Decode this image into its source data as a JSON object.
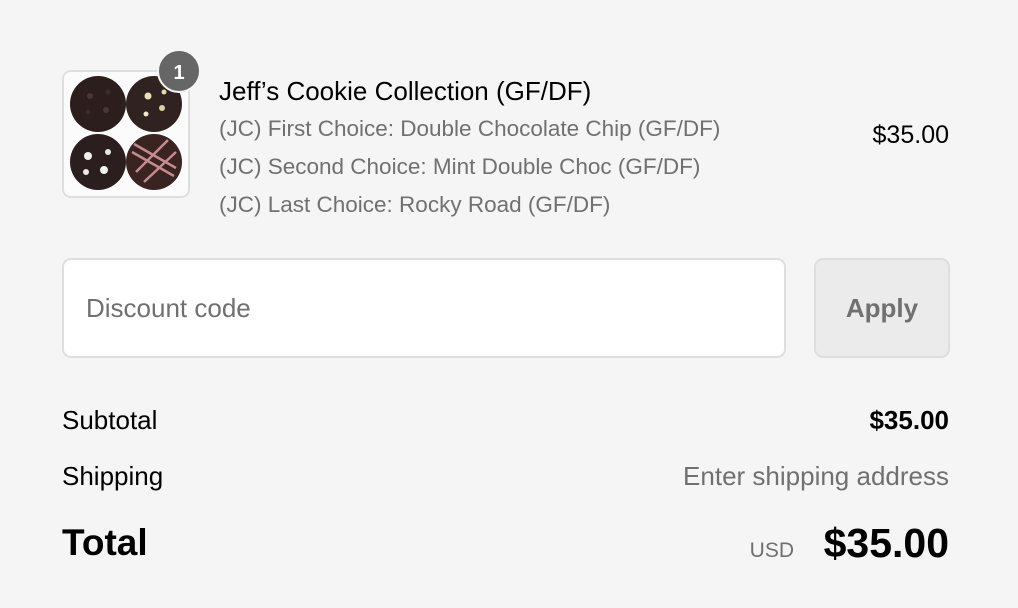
{
  "order": {
    "item": {
      "quantity": "1",
      "title": "Jeff’s Cookie Collection (GF/DF)",
      "variants": [
        "(JC) First Choice: Double Chocolate Chip (GF/DF)",
        "(JC) Second Choice: Mint Double Choc (GF/DF)",
        "(JC) Last Choice: Rocky Road (GF/DF)"
      ],
      "price": "$35.00",
      "image_icon": "cookie-box-photo"
    },
    "discount": {
      "placeholder": "Discount code",
      "value": "",
      "apply_label": "Apply"
    },
    "summary": {
      "subtotal_label": "Subtotal",
      "subtotal_value": "$35.00",
      "shipping_label": "Shipping",
      "shipping_value": "Enter shipping address",
      "total_label": "Total",
      "currency": "USD",
      "total_value": "$35.00"
    }
  },
  "colors": {
    "background": "#f5f5f5",
    "muted_text": "#707070",
    "badge": "#666666",
    "border": "#dedede"
  }
}
